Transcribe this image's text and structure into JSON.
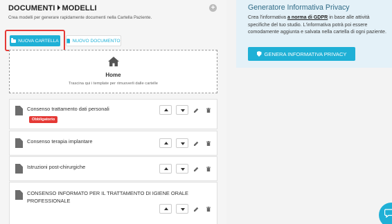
{
  "header": {
    "crumb_parent": "DOCUMENTI",
    "crumb_current": "MODELLI",
    "subtitle": "Crea modelli per generare rapidamente documenti nella Cartella Paziente."
  },
  "toolbar": {
    "new_folder_label": "NUOVA CARTELLA",
    "new_document_label": "NUOVO DOCUMENTO"
  },
  "home_folder": {
    "label": "Home",
    "hint": "Trascina qui i template per rimuoverli dalle cartelle"
  },
  "documents": [
    {
      "title": "Consenso trattamento dati personali",
      "badge": "Obbligatorio"
    },
    {
      "title": "Consenso terapia implantare"
    },
    {
      "title": "Istruzioni post-chirurgiche"
    },
    {
      "title_line1": "CONSENSO INFORMATO PER IL TRATTAMENTO DI IGIENE ORALE",
      "title_line2": "PROFESSIONALE"
    }
  ],
  "privacy_panel": {
    "title": "Generatore Informativa Privacy",
    "text_before_link": "Crea l'informativa ",
    "link_text": "a norma di GDPR",
    "text_after_link": " in base alle attività specifiche del tuo studio. L'informativa potrà poi essere comodamente aggiunta e salvata nella cartella di ogni paziente.",
    "button_label": "GENERA INFORMATIVA PRIVACY"
  },
  "icons": {
    "add": "plus-circle-icon",
    "folder": "folder-icon",
    "file": "file-icon",
    "home": "home-icon",
    "move_up": "caret-up-icon",
    "move_down": "caret-down-icon",
    "edit": "pencil-icon",
    "delete": "trash-icon",
    "privacy": "shield-icon",
    "chat": "chat-bubble-icon"
  },
  "colors": {
    "accent": "#1fb0d6",
    "danger": "#e53935",
    "panel_bg": "#e4f1f8",
    "panel_title": "#2f6b86"
  }
}
